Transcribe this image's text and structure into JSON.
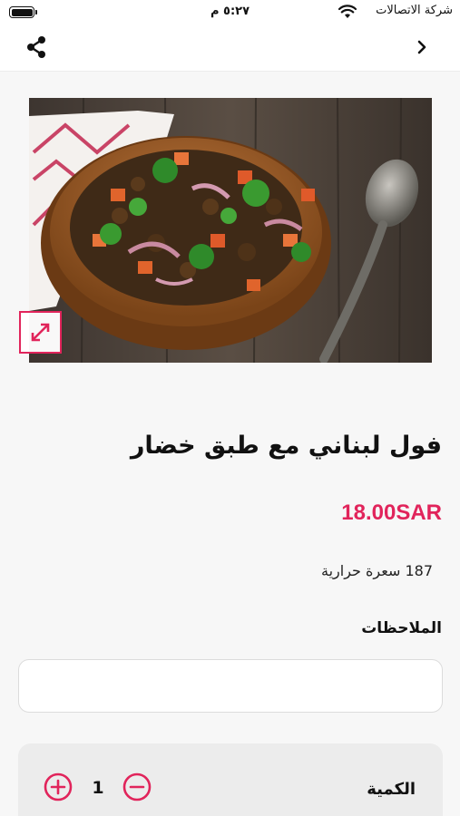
{
  "status_bar": {
    "carrier": "شركة الاتصالات",
    "time": "٥:٢٧ م"
  },
  "nav": {
    "share_icon": "share-icon",
    "back_icon": "chevron-right-icon"
  },
  "product": {
    "image_alt": "Lebanese foul salad in a wooden bowl",
    "name": "فول لبناني مع طبق خضار",
    "price": "18.00SAR",
    "calories": "187 سعرة حرارية"
  },
  "notes": {
    "label": "الملاحظات",
    "value": "",
    "placeholder": ""
  },
  "quantity": {
    "label": "الكمية",
    "value": "1"
  },
  "colors": {
    "accent": "#e1245b",
    "background": "#f7f7f7",
    "panel": "#ececec"
  }
}
